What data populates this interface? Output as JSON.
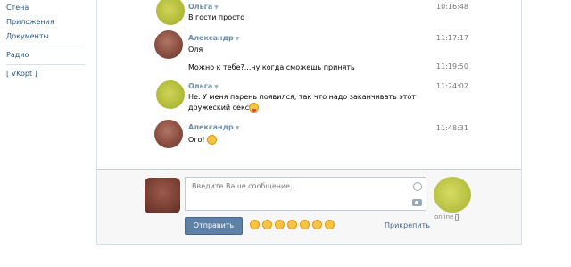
{
  "sidebar": {
    "items": [
      {
        "label": "Стена"
      },
      {
        "label": "Приложения"
      },
      {
        "label": "Документы"
      },
      {
        "label": "Радио"
      },
      {
        "label": "[ VKopt ]"
      }
    ]
  },
  "messages": [
    {
      "author": "Ольга",
      "text": "В гости просто",
      "time": "10:16:48"
    },
    {
      "author": "Александр",
      "text": "Оля",
      "time": "11:17:17"
    },
    {
      "author": "",
      "text": "Можно к тебе?...ну когда сможешь принять",
      "time": "11:19:50"
    },
    {
      "author": "Ольга",
      "text": "Не. У меня парень появился, так что надо заканчивать этот",
      "text2": "дружеский секс",
      "time": "11:24:02"
    },
    {
      "author": "Александр",
      "text": "Ого!",
      "time": "11:48:31"
    }
  ],
  "compose": {
    "placeholder": "Введите Ваше сообщение..",
    "send_label": "Отправить",
    "attach_label": "Прикрепить",
    "status": "online"
  },
  "icons": {
    "author_menu": "triangle-down-icon",
    "smile": "smile-icon",
    "camera": "camera-icon",
    "phone": "mobile-phone-icon"
  },
  "colors": {
    "link": "#2b587a",
    "author": "#6f8fa8",
    "button": "#5e81a8",
    "compose_bg": "#f7f7f7"
  }
}
